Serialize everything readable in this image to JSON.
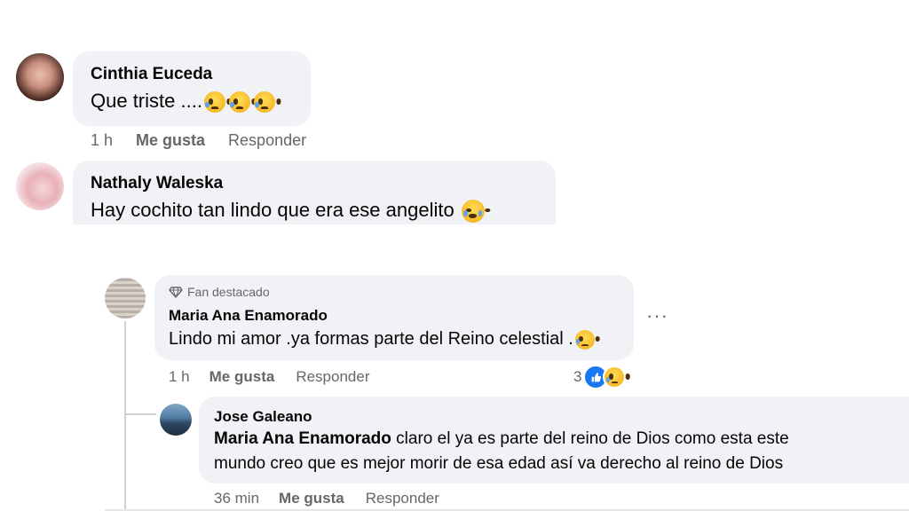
{
  "comments": [
    {
      "author": "Cinthia Euceda",
      "text": "Que triste ....",
      "emojis": [
        "sad-face-emoji",
        "sad-face-emoji",
        "sad-face-emoji"
      ],
      "time": "1 h",
      "like_label": "Me gusta",
      "reply_label": "Responder"
    },
    {
      "author": "Nathaly Waleska",
      "text": "Hay cochito tan lindo que era ese angelito",
      "emojis": [
        "crying-face-emoji"
      ]
    }
  ],
  "reply_thread": {
    "badge_label": "Fan destacado",
    "author": "Maria Ana Enamorado",
    "text": "Lindo mi amor .ya formas parte del Reino celestial .",
    "time": "1 h",
    "like_label": "Me gusta",
    "reply_label": "Responder",
    "reaction_count": "3",
    "more_label": "···",
    "nested_reply": {
      "author": "Jose Galeano",
      "mention": "Maria Ana Enamorado",
      "text_line1": " claro el ya es parte del reino de Dios como esta este",
      "text_line2": "mundo creo que es mejor morir de esa edad así va derecho al reino de Dios",
      "time": "36 min",
      "like_label": "Me gusta",
      "reply_label": "Responder"
    }
  }
}
